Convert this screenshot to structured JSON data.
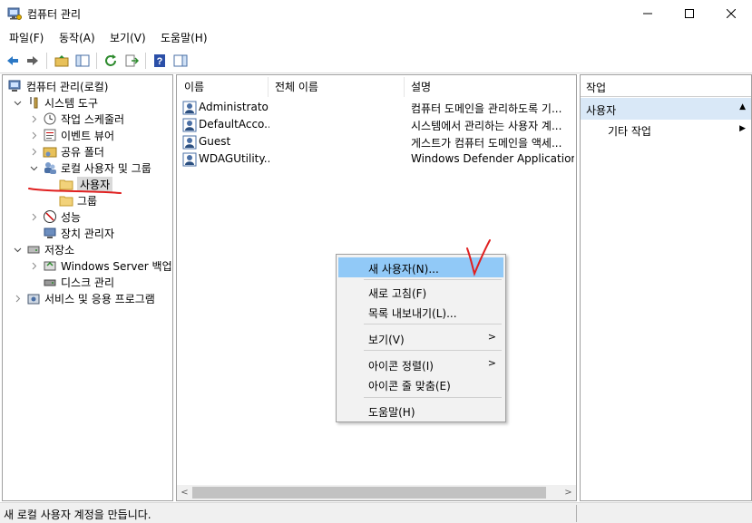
{
  "window": {
    "title": "컴퓨터 관리",
    "controls": {
      "minimize": "—",
      "maximize": "☐",
      "close": "✕"
    }
  },
  "menubar": [
    {
      "label": "파일(F)"
    },
    {
      "label": "동작(A)"
    },
    {
      "label": "보기(V)"
    },
    {
      "label": "도움말(H)"
    }
  ],
  "toolbar": [
    "back-icon",
    "forward-icon",
    "up-folder-icon",
    "show-hide-tree-icon",
    "refresh-icon",
    "export-list-icon",
    "help-icon",
    "show-action-pane-icon"
  ],
  "tree": {
    "items": [
      {
        "label": "컴퓨터 관리(로컬)",
        "icon": "computer-management-icon",
        "expander": "",
        "level": 0
      },
      {
        "label": "시스템 도구",
        "icon": "tools-icon",
        "expander": "open",
        "level": 1
      },
      {
        "label": "작업 스케줄러",
        "icon": "clock-icon",
        "expander": "closed",
        "level": 2
      },
      {
        "label": "이벤트 뷰어",
        "icon": "event-viewer-icon",
        "expander": "closed",
        "level": 2
      },
      {
        "label": "공유 폴더",
        "icon": "shared-folder-icon",
        "expander": "closed",
        "level": 2
      },
      {
        "label": "로컬 사용자 및 그룹",
        "icon": "users-groups-icon",
        "expander": "open",
        "level": 2
      },
      {
        "label": "사용자",
        "icon": "folder-icon",
        "expander": "",
        "level": 3,
        "selected": true
      },
      {
        "label": "그룹",
        "icon": "folder-icon",
        "expander": "",
        "level": 3
      },
      {
        "label": "성능",
        "icon": "performance-icon",
        "expander": "closed",
        "level": 2
      },
      {
        "label": "장치 관리자",
        "icon": "device-manager-icon",
        "expander": "",
        "level": 2
      },
      {
        "label": "저장소",
        "icon": "storage-icon",
        "expander": "open",
        "level": 1
      },
      {
        "label": "Windows Server 백업",
        "icon": "backup-icon",
        "expander": "closed",
        "level": 2
      },
      {
        "label": "디스크 관리",
        "icon": "disk-management-icon",
        "expander": "",
        "level": 2
      },
      {
        "label": "서비스 및 응용 프로그램",
        "icon": "services-icon",
        "expander": "closed",
        "level": 1
      }
    ]
  },
  "list": {
    "columns": [
      "이름",
      "전체 이름",
      "설명"
    ],
    "rows": [
      {
        "name": "Administrator",
        "full_name": "",
        "description": "컴퓨터 도메인을 관리하도록 기..."
      },
      {
        "name": "DefaultAcco...",
        "full_name": "",
        "description": "시스템에서 관리하는 사용자 계..."
      },
      {
        "name": "Guest",
        "full_name": "",
        "description": "게스트가 컴퓨터 도메인을 액세..."
      },
      {
        "name": "WDAGUtility...",
        "full_name": "",
        "description": "Windows Defender Application G..."
      }
    ],
    "scroll_arrows": {
      "left": "<",
      "right": ">"
    }
  },
  "actions": {
    "header": "작업",
    "section": "사용자",
    "section_arrow": "▲",
    "items": [
      {
        "label": "기타 작업",
        "arrow": "▶"
      }
    ]
  },
  "context_menu": {
    "items": [
      {
        "label": "새 사용자(N)...",
        "highlighted": true
      },
      {
        "label": "새로 고침(F)"
      },
      {
        "label": "목록 내보내기(L)..."
      },
      {
        "label": "보기(V)",
        "submenu": ">"
      },
      {
        "label": "아이콘 정렬(I)",
        "submenu": ">"
      },
      {
        "label": "아이콘 줄 맞춤(E)"
      },
      {
        "label": "도움말(H)"
      }
    ]
  },
  "status_bar": {
    "text": "새 로컬 사용자 계정을 만듭니다."
  },
  "annotations": {
    "check_mark_color": "#e02020",
    "underline_color": "#e02020"
  },
  "colors": {
    "selection": "#91c9f7",
    "action_section": "#d9e8f7",
    "tree_selected": "#d9d9d9"
  }
}
